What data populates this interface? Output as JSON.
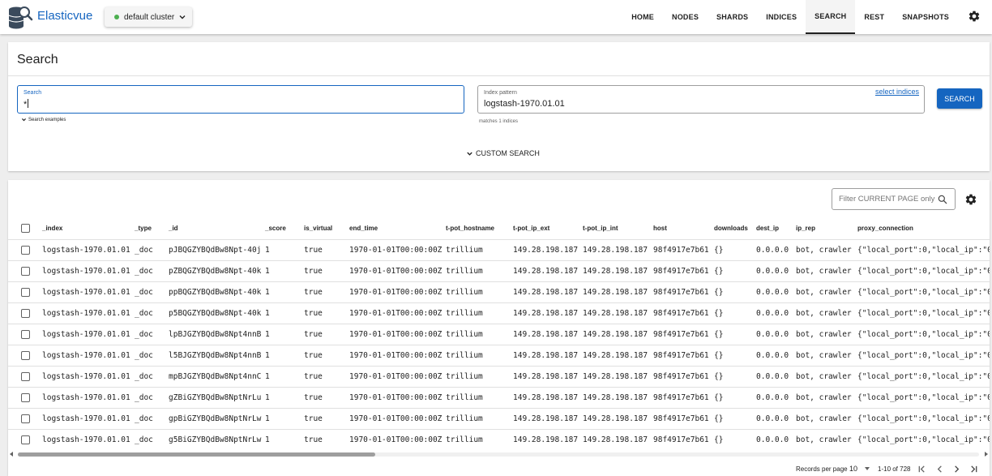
{
  "app": {
    "title": "Elasticvue",
    "cluster_label": "default cluster"
  },
  "nav": {
    "items": [
      "HOME",
      "NODES",
      "SHARDS",
      "INDICES",
      "SEARCH",
      "REST",
      "SNAPSHOTS"
    ],
    "active": "SEARCH"
  },
  "search": {
    "title": "Search",
    "query_label": "Search",
    "query_value": "*",
    "examples_label": "Search examples",
    "index_label": "Index pattern",
    "index_value": "logstash-1970.01.01",
    "select_indices_label": "select indices",
    "matches_text": "matches 1 indices",
    "search_button": "SEARCH",
    "custom_search_label": "CUSTOM SEARCH"
  },
  "results": {
    "filter_placeholder": "Filter CURRENT PAGE only",
    "columns": [
      "_index",
      "_type",
      "_id",
      "_score",
      "is_virtual",
      "end_time",
      "t-pot_hostname",
      "t-pot_ip_ext",
      "t-pot_ip_int",
      "host",
      "downloads",
      "dest_ip",
      "ip_rep",
      "proxy_connection"
    ],
    "rows": [
      [
        "logstash-1970.01.01",
        "_doc",
        "pJBQGZYBQdBw8Npt-40j",
        "1",
        "true",
        "1970-01-01T00:00:00Z",
        "trillium",
        "149.28.198.187",
        "149.28.198.187",
        "98f4917e7b61",
        "{}",
        "0.0.0.0",
        "bot, crawler",
        "{\"local_port\":0,\"local_ip\":\"0."
      ],
      [
        "logstash-1970.01.01",
        "_doc",
        "pZBQGZYBQdBw8Npt-40k",
        "1",
        "true",
        "1970-01-01T00:00:00Z",
        "trillium",
        "149.28.198.187",
        "149.28.198.187",
        "98f4917e7b61",
        "{}",
        "0.0.0.0",
        "bot, crawler",
        "{\"local_port\":0,\"local_ip\":\"0."
      ],
      [
        "logstash-1970.01.01",
        "_doc",
        "ppBQGZYBQdBw8Npt-40k",
        "1",
        "true",
        "1970-01-01T00:00:00Z",
        "trillium",
        "149.28.198.187",
        "149.28.198.187",
        "98f4917e7b61",
        "{}",
        "0.0.0.0",
        "bot, crawler",
        "{\"local_port\":0,\"local_ip\":\"0."
      ],
      [
        "logstash-1970.01.01",
        "_doc",
        "p5BQGZYBQdBw8Npt-40k",
        "1",
        "true",
        "1970-01-01T00:00:00Z",
        "trillium",
        "149.28.198.187",
        "149.28.198.187",
        "98f4917e7b61",
        "{}",
        "0.0.0.0",
        "bot, crawler",
        "{\"local_port\":0,\"local_ip\":\"0."
      ],
      [
        "logstash-1970.01.01",
        "_doc",
        "lpBJGZYBQdBw8Npt4nnB",
        "1",
        "true",
        "1970-01-01T00:00:00Z",
        "trillium",
        "149.28.198.187",
        "149.28.198.187",
        "98f4917e7b61",
        "{}",
        "0.0.0.0",
        "bot, crawler",
        "{\"local_port\":0,\"local_ip\":\"0."
      ],
      [
        "logstash-1970.01.01",
        "_doc",
        "l5BJGZYBQdBw8Npt4nnB",
        "1",
        "true",
        "1970-01-01T00:00:00Z",
        "trillium",
        "149.28.198.187",
        "149.28.198.187",
        "98f4917e7b61",
        "{}",
        "0.0.0.0",
        "bot, crawler",
        "{\"local_port\":0,\"local_ip\":\"0."
      ],
      [
        "logstash-1970.01.01",
        "_doc",
        "mpBJGZYBQdBw8Npt4nnC",
        "1",
        "true",
        "1970-01-01T00:00:00Z",
        "trillium",
        "149.28.198.187",
        "149.28.198.187",
        "98f4917e7b61",
        "{}",
        "0.0.0.0",
        "bot, crawler",
        "{\"local_port\":0,\"local_ip\":\"0."
      ],
      [
        "logstash-1970.01.01",
        "_doc",
        "gZBiGZYBQdBw8NptNrLu",
        "1",
        "true",
        "1970-01-01T00:00:00Z",
        "trillium",
        "149.28.198.187",
        "149.28.198.187",
        "98f4917e7b61",
        "{}",
        "0.0.0.0",
        "bot, crawler",
        "{\"local_port\":0,\"local_ip\":\"0."
      ],
      [
        "logstash-1970.01.01",
        "_doc",
        "gpBiGZYBQdBw8NptNrLw",
        "1",
        "true",
        "1970-01-01T00:00:00Z",
        "trillium",
        "149.28.198.187",
        "149.28.198.187",
        "98f4917e7b61",
        "{}",
        "0.0.0.0",
        "bot, crawler",
        "{\"local_port\":0,\"local_ip\":\"0."
      ],
      [
        "logstash-1970.01.01",
        "_doc",
        "g5BiGZYBQdBw8NptNrLw",
        "1",
        "true",
        "1970-01-01T00:00:00Z",
        "trillium",
        "149.28.198.187",
        "149.28.198.187",
        "98f4917e7b61",
        "{}",
        "0.0.0.0",
        "bot, crawler",
        "{\"local_port\":0,\"local_ip\":\"0."
      ]
    ],
    "footer": {
      "records_label": "Records per page",
      "records_value": "10",
      "range_text": "1-10 of 728"
    }
  },
  "colors": {
    "primary": "#1565c0",
    "status_green": "#4caf50"
  }
}
